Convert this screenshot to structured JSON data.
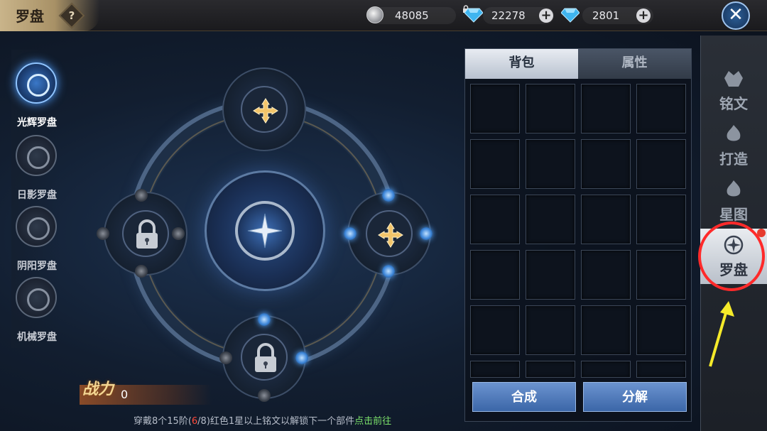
{
  "header": {
    "title": "罗盘",
    "help_label": "?",
    "close_label": "✕",
    "currencies": [
      {
        "icon": "silver-coin-icon",
        "value": "48085"
      },
      {
        "icon": "locked-diamond-icon",
        "value": "22278"
      },
      {
        "icon": "diamond-icon",
        "value": "2801"
      }
    ],
    "plus_label": "+"
  },
  "left_tabs": [
    {
      "label": "光辉罗盘",
      "active": true
    },
    {
      "label": "日影罗盘",
      "active": false
    },
    {
      "label": "阴阳罗盘",
      "active": false
    },
    {
      "label": "机械罗盘",
      "active": false
    }
  ],
  "power": {
    "label": "战力",
    "value": "0"
  },
  "hint": {
    "prefix": "穿戴8个15阶(",
    "current": "6",
    "suffix": "/8)红色1星以上铭文以解锁下一个部件",
    "link": "点击前往"
  },
  "inventory": {
    "tabs": [
      {
        "label": "背包",
        "active": true
      },
      {
        "label": "属性",
        "active": false
      }
    ],
    "buttons": {
      "combine": "合成",
      "decompose": "分解"
    }
  },
  "right_tabs": [
    {
      "label": "铭文",
      "icon": "inscription-icon",
      "active": false
    },
    {
      "label": "打造",
      "icon": "forge-icon",
      "active": false
    },
    {
      "label": "星图",
      "icon": "star-map-icon",
      "active": false
    },
    {
      "label": "罗盘",
      "icon": "compass-icon",
      "active": true
    }
  ],
  "colors": {
    "accent_blue": "#3b66a8",
    "highlight_red": "#ff2a2a",
    "arrow_yellow": "#f5ea2a"
  }
}
